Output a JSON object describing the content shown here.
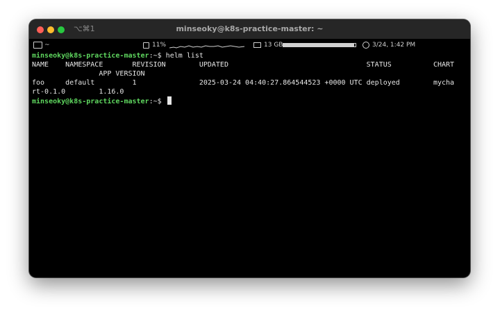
{
  "window": {
    "shortcut": "⌥⌘1",
    "title": "minseoky@k8s-practice-master: ~"
  },
  "statusbar": {
    "cwd": "~",
    "cpu": "11%",
    "memory": "13 GB",
    "memory_fraction": 0.98,
    "datetime": "3/24, 1:42 PM"
  },
  "terminal": {
    "prompt_user": "minseoky@k8s-practice-master",
    "prompt_suffix": ":~$ ",
    "command": "helm list",
    "lines": [
      "NAME    NAMESPACE       REVISION        UPDATED                                 STATUS          CHART",
      "                APP VERSION",
      "foo     default         1               2025-03-24 04:40:27.864544523 +0000 UTC deployed        mycha",
      "rt-0.1.0        1.16.0"
    ],
    "prompt2_user": "minseoky@k8s-practice-master",
    "prompt2_suffix": ":~$ "
  }
}
